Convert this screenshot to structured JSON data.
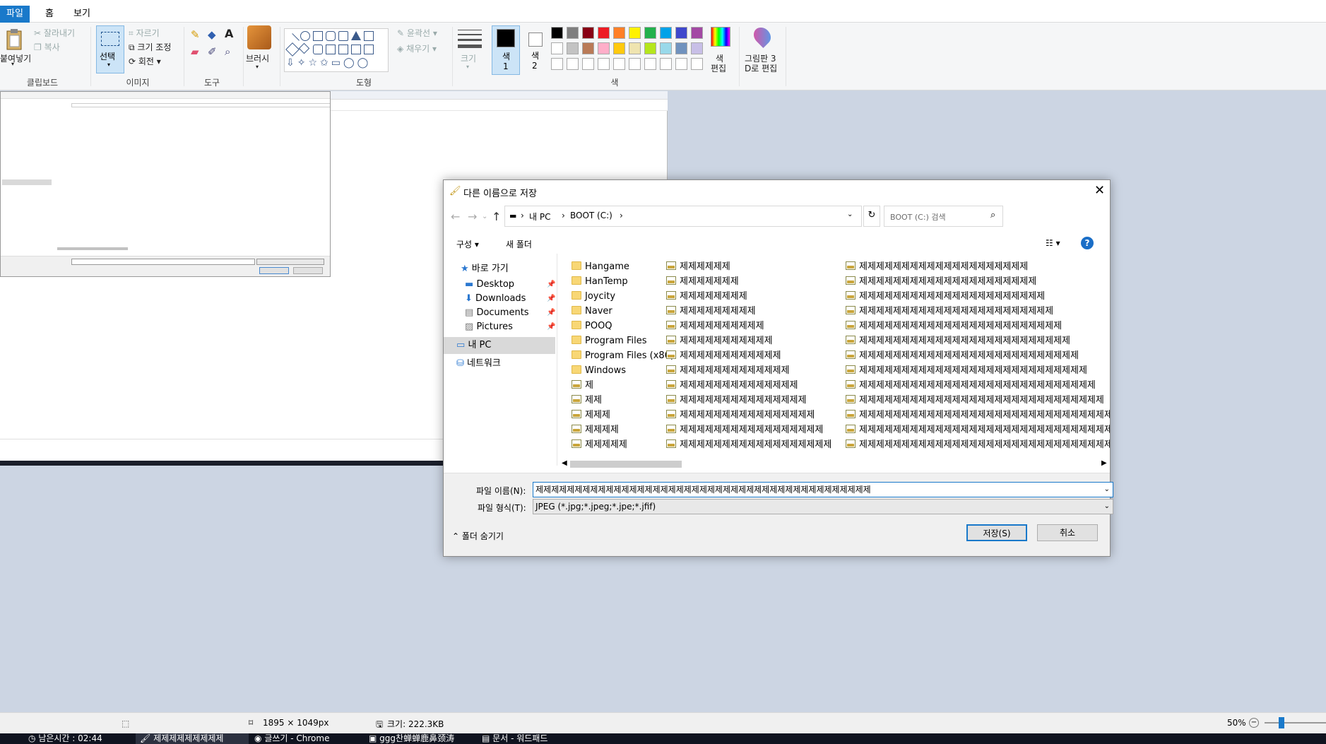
{
  "menu": {
    "file": "파일",
    "home": "홈",
    "view": "보기"
  },
  "ribbon": {
    "clipboard": {
      "paste": "붙여넣기",
      "cut": "잘라내기",
      "copy": "복사",
      "label": "클립보드"
    },
    "image": {
      "select": "선택",
      "crop": "자르기",
      "resize": "크기 조정",
      "rotate": "회전",
      "label": "이미지"
    },
    "tools": {
      "label": "도구"
    },
    "brush": {
      "label": "브러시"
    },
    "shapes": {
      "outline": "윤곽선",
      "fill": "채우기",
      "label": "도형"
    },
    "size": {
      "label": "크기"
    },
    "color1": {
      "label1": "색",
      "label2": "1"
    },
    "color2": {
      "label1": "색",
      "label2": "2"
    },
    "edit_colors": {
      "label1": "색",
      "label2": "편집"
    },
    "paint3d": {
      "label1": "그림판 3",
      "label2": "D로 편집"
    },
    "colors_label": "색",
    "palette_row1": [
      "#000000",
      "#7f7f7f",
      "#880015",
      "#ed1c24",
      "#ff7f27",
      "#fff200",
      "#22b14c",
      "#00a2e8",
      "#3f48cc",
      "#a349a4"
    ],
    "palette_row2": [
      "#ffffff",
      "#c3c3c3",
      "#b97a57",
      "#ffaec9",
      "#ffc90e",
      "#efe4b0",
      "#b5e61d",
      "#99d9ea",
      "#7092be",
      "#c8bfe7"
    ]
  },
  "dialog": {
    "title": "다른 이름으로 저장",
    "breadcrumb": [
      "내 PC",
      "BOOT (C:)"
    ],
    "search_placeholder": "BOOT (C:) 검색",
    "organize": "구성",
    "new_folder": "새 폴더",
    "help": "?",
    "nav": {
      "quick_access": "바로 가기",
      "desktop": "Desktop",
      "downloads": "Downloads",
      "documents": "Documents",
      "pictures": "Pictures",
      "this_pc": "내 PC",
      "network": "네트워크"
    },
    "col1": [
      {
        "name": "Hangame",
        "type": "folder"
      },
      {
        "name": "HanTemp",
        "type": "folder"
      },
      {
        "name": "Joycity",
        "type": "folder"
      },
      {
        "name": "Naver",
        "type": "folder"
      },
      {
        "name": "POOQ",
        "type": "folder"
      },
      {
        "name": "Program Files",
        "type": "folder"
      },
      {
        "name": "Program Files (x86)",
        "type": "folder"
      },
      {
        "name": "Windows",
        "type": "folder"
      },
      {
        "name": "제",
        "type": "jpg"
      },
      {
        "name": "제제",
        "type": "jpg"
      },
      {
        "name": "제제제",
        "type": "jpg"
      },
      {
        "name": "제제제제",
        "type": "jpg"
      },
      {
        "name": "제제제제제",
        "type": "jpg"
      }
    ],
    "col2": [
      "제제제제제제",
      "제제제제제제제",
      "제제제제제제제제",
      "제제제제제제제제제",
      "제제제제제제제제제제",
      "제제제제제제제제제제제",
      "제제제제제제제제제제제제",
      "제제제제제제제제제제제제제",
      "제제제제제제제제제제제제제제",
      "제제제제제제제제제제제제제제제",
      "제제제제제제제제제제제제제제제제",
      "제제제제제제제제제제제제제제제제제",
      "제제제제제제제제제제제제제제제제제제"
    ],
    "col3": [
      "제제제제제제제제제제제제제제제제제제제제",
      "제제제제제제제제제제제제제제제제제제제제제",
      "제제제제제제제제제제제제제제제제제제제제제제",
      "제제제제제제제제제제제제제제제제제제제제제제제",
      "제제제제제제제제제제제제제제제제제제제제제제제제",
      "제제제제제제제제제제제제제제제제제제제제제제제제제",
      "제제제제제제제제제제제제제제제제제제제제제제제제제제",
      "제제제제제제제제제제제제제제제제제제제제제제제제제제제",
      "제제제제제제제제제제제제제제제제제제제제제제제제제제제제",
      "제제제제제제제제제제제제제제제제제제제제제제제제제제제제제",
      "제제제제제제제제제제제제제제제제제제제제제제제제제제제제제제",
      "제제제제제제제제제제제제제제제제제제제제제제제제제제제제제제제",
      "제제제제제제제제제제제제제제제제제제제제제제제제제제제제제제제제"
    ],
    "filename_label": "파일 이름(N):",
    "filename_value": "제제제제제제제제제제제제제제제제제제제제제제제제제제제제제제제제제제제제제제제제제제제",
    "filetype_label": "파일 형식(T):",
    "filetype_value": "JPEG (*.jpg;*.jpeg;*.jpe;*.jfif)",
    "hide_folders": "폴더 숨기기",
    "save": "저장(S)",
    "cancel": "취소"
  },
  "status": {
    "dimensions": "1895 × 1049px",
    "size": "크기: 222.3KB",
    "zoom": "50%"
  },
  "taskbar": [
    "남은시간 : 02:44",
    "제제제제제제제제제",
    "글쓰기 - Chrome",
    "ggg찬蝉蝉鹿鼻颈涛",
    "문서 - 워드패드"
  ]
}
